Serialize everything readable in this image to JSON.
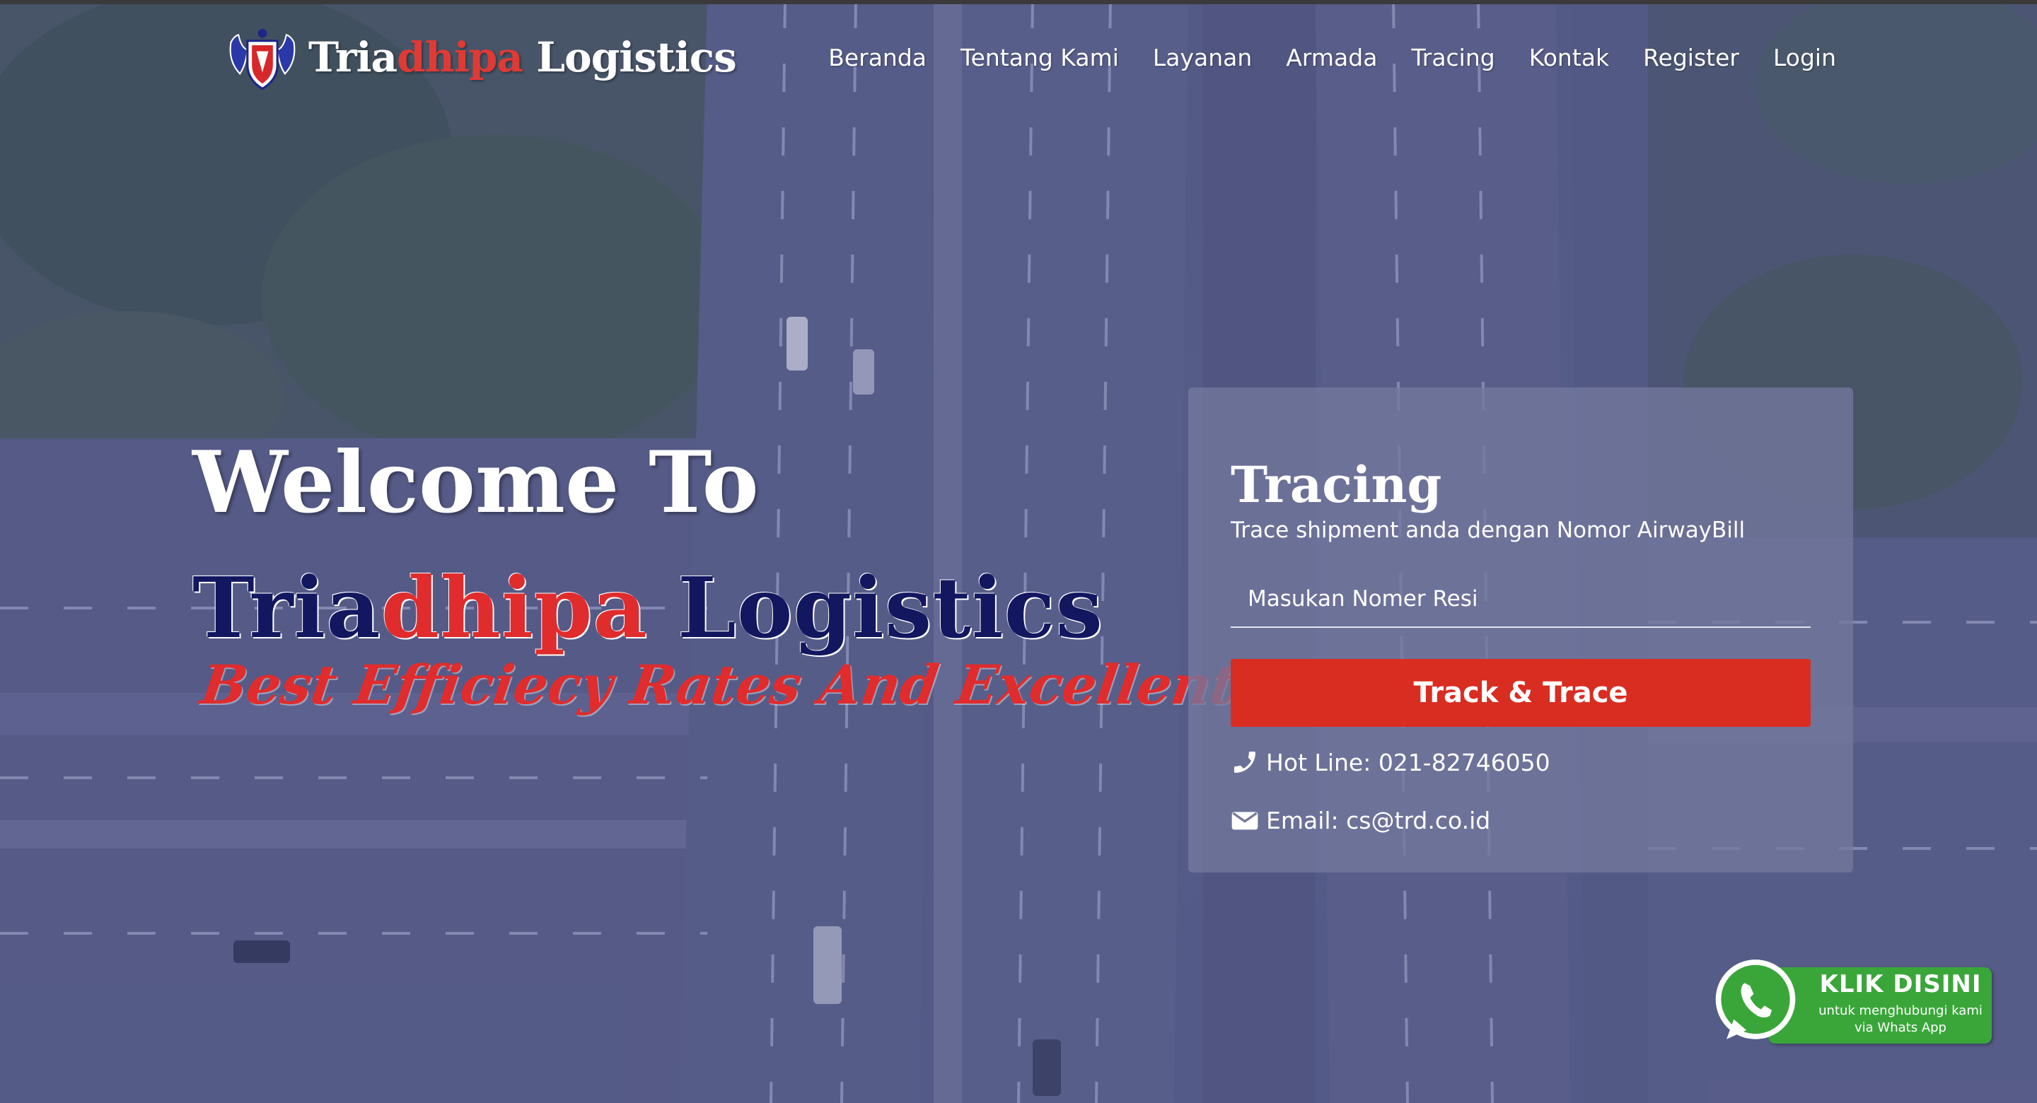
{
  "brand": {
    "name_part1": "Tria",
    "name_part2": "dhipa",
    "name_part3": " Logistics",
    "logo_icon": "eagle-shield-icon"
  },
  "nav": {
    "items": [
      {
        "label": "Beranda"
      },
      {
        "label": "Tentang Kami"
      },
      {
        "label": "Layanan"
      },
      {
        "label": "Armada"
      },
      {
        "label": "Tracing"
      },
      {
        "label": "Kontak"
      },
      {
        "label": "Register"
      },
      {
        "label": "Login"
      }
    ]
  },
  "hero": {
    "welcome": "Welcome To",
    "company_part1": "Tria",
    "company_part2": "dhipa",
    "company_part3": " Logistics",
    "tagline": "Best Efficiecy Rates And Excellent Services"
  },
  "tracing": {
    "title": "Tracing",
    "subtitle": "Trace shipment anda dengan Nomor AirwayBill",
    "input_placeholder": "Masukan Nomer Resi",
    "button_label": "Track & Trace",
    "hotline": "Hot Line: 021-82746050",
    "email": "Email: cs@trd.co.id",
    "hotline_icon": "phone-icon",
    "email_icon": "envelope-icon"
  },
  "whatsapp": {
    "title": "KLIK DISINI",
    "subtitle_line1": "untuk menghubungi kami",
    "subtitle_line2": "via Whats App",
    "icon": "whatsapp-icon"
  },
  "colors": {
    "accent_red": "#d92d21",
    "brand_navy": "#13175f",
    "whatsapp_green": "#3aa63a"
  }
}
